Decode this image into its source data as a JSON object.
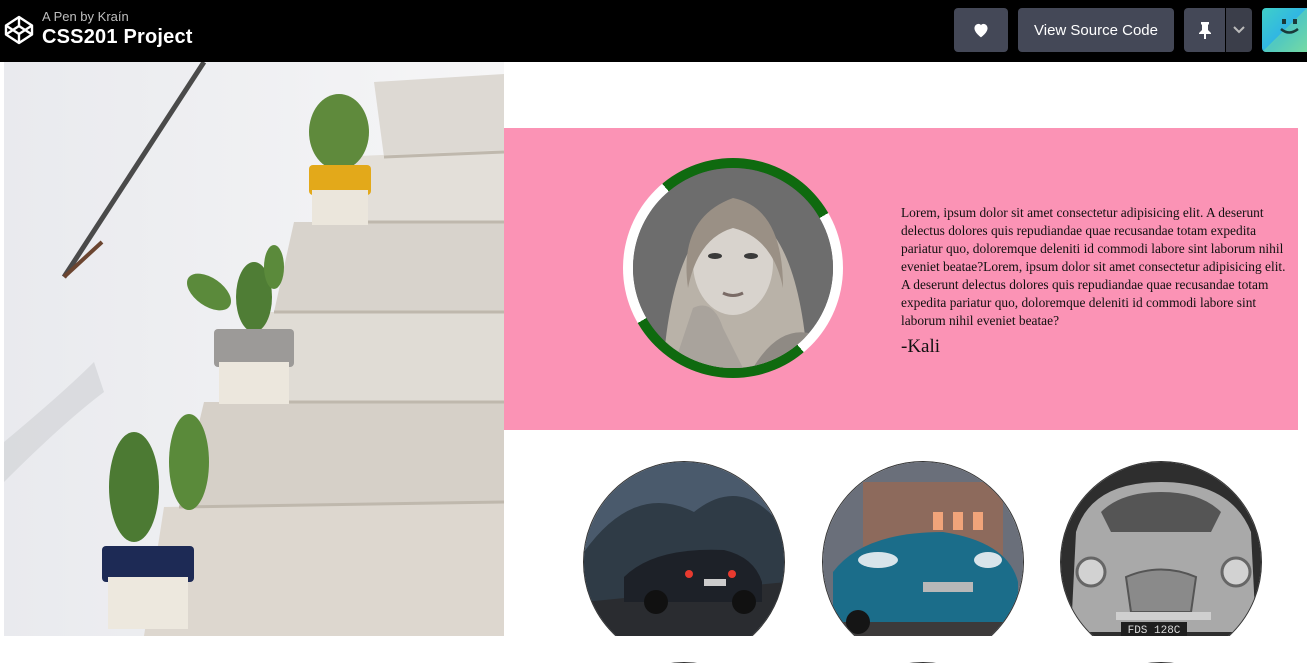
{
  "header": {
    "pen_by": "A Pen by Kraín",
    "title": "CSS201 Project",
    "logo_icon": "codepen-logo-icon",
    "heart_icon": "heart-icon",
    "view_source_label": "View Source Code",
    "pin_icon": "pin-icon",
    "caret_icon": "chevron-down-icon",
    "avatar_icon": "user-avatar"
  },
  "left_photo": {
    "subject": "cactus-pots-on-white-stairs"
  },
  "testimonial": {
    "text": "Lorem, ipsum dolor sit amet consectetur adipisicing elit. A deserunt delectus dolores quis repudiandae quae recusandae totam expedita pariatur quo, doloremque deleniti id commodi labore sint laborum nihil eveniet beatae?Lorem, ipsum dolor sit amet consectetur adipisicing elit. A deserunt delectus dolores quis repudiandae quae recusandae totam expedita pariatur quo, doloremque deleniti id commodi labore sint laborum nihil eveniet beatae?",
    "author": "-Kali",
    "band_color": "#fb93b5",
    "ring_color": "#0f6a0f"
  },
  "cars": [
    {
      "name": "dark-sports-car-photo",
      "plate": ""
    },
    {
      "name": "blue-sports-car-photo",
      "plate": ""
    },
    {
      "name": "classic-silver-car-photo",
      "plate": "FDS 128C"
    }
  ]
}
